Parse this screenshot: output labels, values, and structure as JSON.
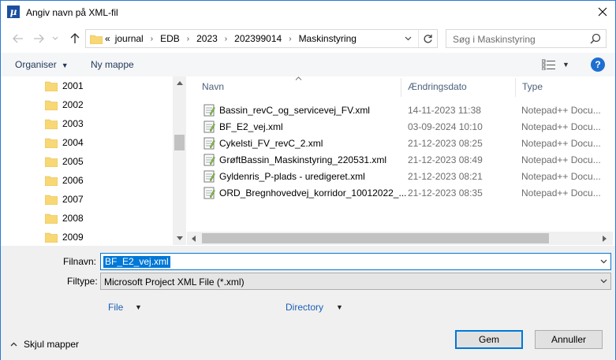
{
  "window": {
    "title": "Angiv navn på XML-fil"
  },
  "address": {
    "prefix": "«",
    "crumbs": [
      "journal",
      "EDB",
      "2023",
      "202399014",
      "Maskinstyring"
    ]
  },
  "search": {
    "placeholder": "Søg i Maskinstyring"
  },
  "commandbar": {
    "organise": "Organiser",
    "new_folder": "Ny mappe"
  },
  "tree": {
    "items": [
      "2001",
      "2002",
      "2003",
      "2004",
      "2005",
      "2006",
      "2007",
      "2008",
      "2009"
    ]
  },
  "columns": {
    "name": "Navn",
    "date": "Ændringsdato",
    "type": "Type"
  },
  "files": [
    {
      "name": "Bassin_revC_og_servicevej_FV.xml",
      "date": "14-11-2023 11:38",
      "type": "Notepad++ Docu..."
    },
    {
      "name": "BF_E2_vej.xml",
      "date": "03-09-2024 10:10",
      "type": "Notepad++ Docu..."
    },
    {
      "name": "Cykelsti_FV_revC_2.xml",
      "date": "21-12-2023 08:25",
      "type": "Notepad++ Docu..."
    },
    {
      "name": "GrøftBassin_Maskinstyring_220531.xml",
      "date": "21-12-2023 08:49",
      "type": "Notepad++ Docu..."
    },
    {
      "name": "Gyldenris_P-plads - uredigeret.xml",
      "date": "21-12-2023 08:21",
      "type": "Notepad++ Docu..."
    },
    {
      "name": "ORD_Bregnhovedvej_korridor_10012022_...",
      "date": "21-12-2023 08:35",
      "type": "Notepad++ Docu..."
    }
  ],
  "form": {
    "filename_label": "Filnavn:",
    "filename_value": "BF_E2_vej.xml",
    "filetype_label": "Filtype:",
    "filetype_value": "Microsoft Project XML File (*.xml)",
    "option_file": "File",
    "option_directory": "Directory"
  },
  "footer": {
    "hide_folders": "Skjul mapper",
    "save": "Gem",
    "cancel": "Annuller"
  },
  "colors": {
    "accent": "#0078d7",
    "link": "#1a5fb4",
    "folder": "#f8d775"
  }
}
